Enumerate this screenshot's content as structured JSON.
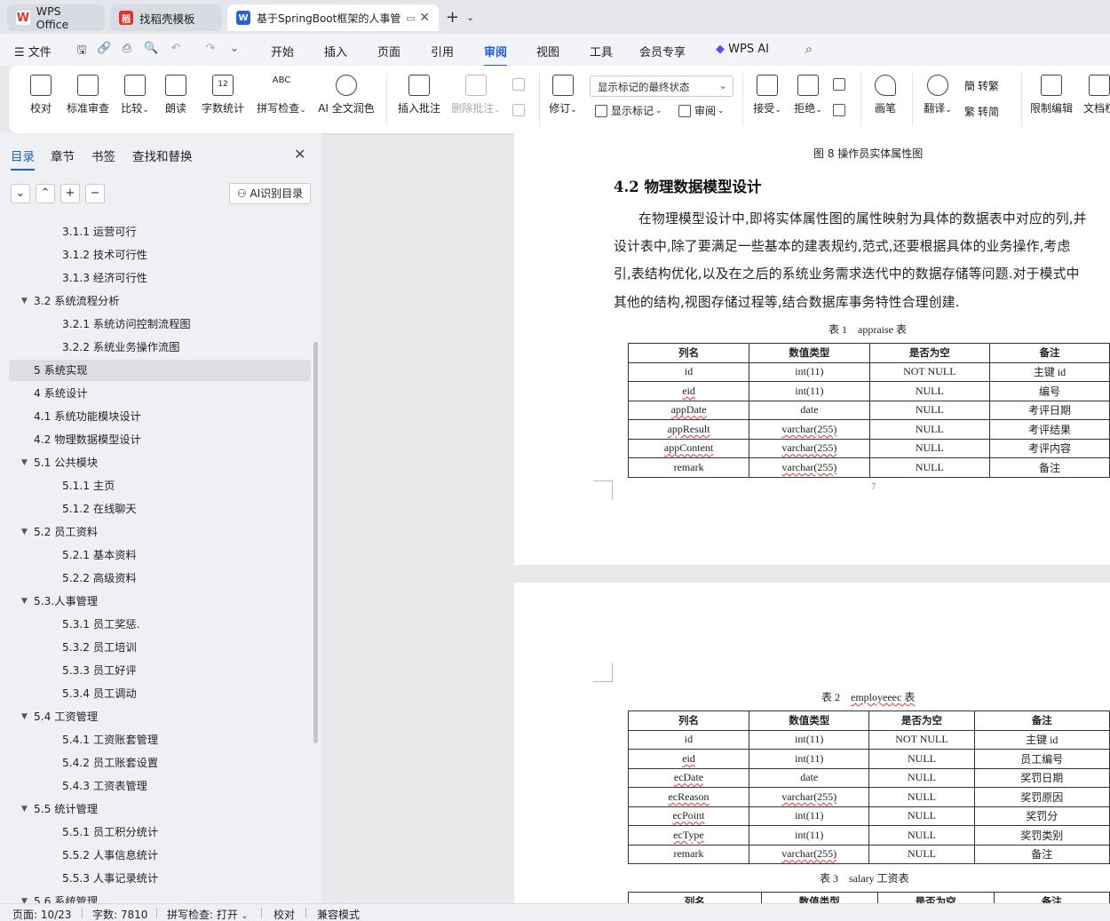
{
  "tabs": [
    {
      "label": "WPS Office",
      "icon": "wps-logo-icon",
      "color": "#e2332b"
    },
    {
      "label": "找稻壳模板",
      "icon": "docer-icon",
      "color": "#e2332b"
    },
    {
      "label": "基于SpringBoot框架的人事管",
      "icon": "writer-doc-icon",
      "color": "#2a62d6"
    }
  ],
  "menu": {
    "file": "文件",
    "items": [
      "开始",
      "插入",
      "页面",
      "引用",
      "审阅",
      "视图",
      "工具",
      "会员专享"
    ],
    "active": "审阅",
    "wps_ai": "WPS AI"
  },
  "ribbon": {
    "proofread": "校对",
    "std_review": "标准审查",
    "compare": "比较",
    "read_aloud": "朗读",
    "word_count": "字数统计",
    "spell_check": "拼写检查",
    "ai_polish": "AI 全文润色",
    "insert_comment": "插入批注",
    "delete_comment": "删除批注",
    "track_changes": "修订",
    "markup_dropdown": "显示标记的最终状态",
    "show_markup": "显示标记",
    "review": "审阅",
    "accept": "接受",
    "reject": "拒绝",
    "pen": "画笔",
    "translate": "翻译",
    "to_traditional": "转繁",
    "to_simplified": "转简",
    "restrict_edit": "限制编辑",
    "doc_permission": "文档权"
  },
  "left_panel": {
    "tabs": [
      "目录",
      "章节",
      "书签",
      "查找和替换"
    ],
    "ai_toc_button": "AI识别目录",
    "toc": [
      {
        "label": "3.1.1 运营可行",
        "level": 3
      },
      {
        "label": "3.1.2 技术可行性",
        "level": 3
      },
      {
        "label": "3.1.3 经济可行性",
        "level": 3
      },
      {
        "label": "3.2 系统流程分析",
        "level": 2,
        "caret": true
      },
      {
        "label": "3.2.1 系统访问控制流程图",
        "level": 3
      },
      {
        "label": "3.2.2 系统业务操作流图",
        "level": 3
      },
      {
        "label": "5 系统实现",
        "level": 1,
        "selected": true
      },
      {
        "label": "4 系统设计",
        "level": 1
      },
      {
        "label": "4.1 系统功能模块设计",
        "level": 1
      },
      {
        "label": "4.2 物理数据模型设计",
        "level": 1
      },
      {
        "label": "5.1  公共模块",
        "level": 2,
        "caret": true
      },
      {
        "label": "5.1.1 主页",
        "level": 3
      },
      {
        "label": "5.1.2 在线聊天",
        "level": 3
      },
      {
        "label": "5.2  员工资料",
        "level": 2,
        "caret": true
      },
      {
        "label": "5.2.1 基本资料",
        "level": 3
      },
      {
        "label": "5.2.2  高级资料",
        "level": 3
      },
      {
        "label": "5.3.人事管理",
        "level": 2,
        "caret": true
      },
      {
        "label": "5.3.1 员工奖惩.",
        "level": 3
      },
      {
        "label": "5.3.2 员工培训",
        "level": 3
      },
      {
        "label": "5.3.3 员工好评",
        "level": 3
      },
      {
        "label": "5.3.4 员工调动",
        "level": 3
      },
      {
        "label": "5.4 工资管理",
        "level": 2,
        "caret": true
      },
      {
        "label": "5.4.1 工资账套管理",
        "level": 3
      },
      {
        "label": "5.4.2 员工账套设置",
        "level": 3
      },
      {
        "label": "5.4.3 工资表管理",
        "level": 3
      },
      {
        "label": "5.5 统计管理",
        "level": 2,
        "caret": true
      },
      {
        "label": "5.5.1 员工积分统计",
        "level": 3
      },
      {
        "label": "5.5.2 人事信息统计",
        "level": 3
      },
      {
        "label": "5.5.3 人事记录统计",
        "level": 3
      },
      {
        "label": "5.6 系统管理",
        "level": 2,
        "caret": true
      }
    ]
  },
  "document": {
    "fig8_caption": "图 8  操作员实体属性图",
    "heading_42": "4.2 物理数据模型设计",
    "paragraph_lines": [
      "在物理模型设计中,即将实体属性图的属性映射为具体的数据表中对应的列,并",
      "设计表中,除了要满足一些基本的建表规约,范式,还要根据具体的业务操作,考虑",
      "引,表结构优化,以及在之后的系统业务需求迭代中的数据存储等问题.对于模式中",
      "其他的结构,视图存储过程等,结合数据库事务特性合理创建."
    ],
    "page_number": "7",
    "columns": [
      "列名",
      "数值类型",
      "是否为空",
      "备注"
    ],
    "table1": {
      "caption_prefix": "表 1",
      "caption_name": "appraise 表",
      "rows": [
        [
          "id",
          "int(11)",
          "NOT NULL",
          "主键 id"
        ],
        [
          "eid",
          "int(11)",
          "NULL",
          "编号"
        ],
        [
          "appDate",
          "date",
          "NULL",
          "考评日期"
        ],
        [
          "appResult",
          "varchar(255)",
          "NULL",
          "考评结果"
        ],
        [
          "appContent",
          "varchar(255)",
          "NULL",
          "考评内容"
        ],
        [
          "remark",
          "varchar(255)",
          "NULL",
          "备注"
        ]
      ]
    },
    "table2": {
      "caption_prefix": "表 2",
      "caption_name": "employeeec 表",
      "rows": [
        [
          "id",
          "int(11)",
          "NOT NULL",
          "主键 id"
        ],
        [
          "eid",
          "int(11)",
          "NULL",
          "员工编号"
        ],
        [
          "ecDate",
          "date",
          "NULL",
          "奖罚日期"
        ],
        [
          "ecReason",
          "varchar(255)",
          "NULL",
          "奖罚原因"
        ],
        [
          "ecPoint",
          "int(11)",
          "NULL",
          "奖罚分"
        ],
        [
          "ecType",
          "int(11)",
          "NULL",
          "奖罚类别"
        ],
        [
          "remark",
          "varchar(255)",
          "NULL",
          "备注"
        ]
      ]
    },
    "table3": {
      "caption_prefix": "表 3",
      "caption_name": "salary   工资表",
      "header_partial": [
        "列名",
        "数值类型",
        "是否为空",
        "备注"
      ]
    }
  },
  "status": {
    "page": "页面: 10/23",
    "words": "字数: 7810",
    "spell": "拼写检查: 打开",
    "proof": "校对",
    "compat": "兼容模式"
  }
}
